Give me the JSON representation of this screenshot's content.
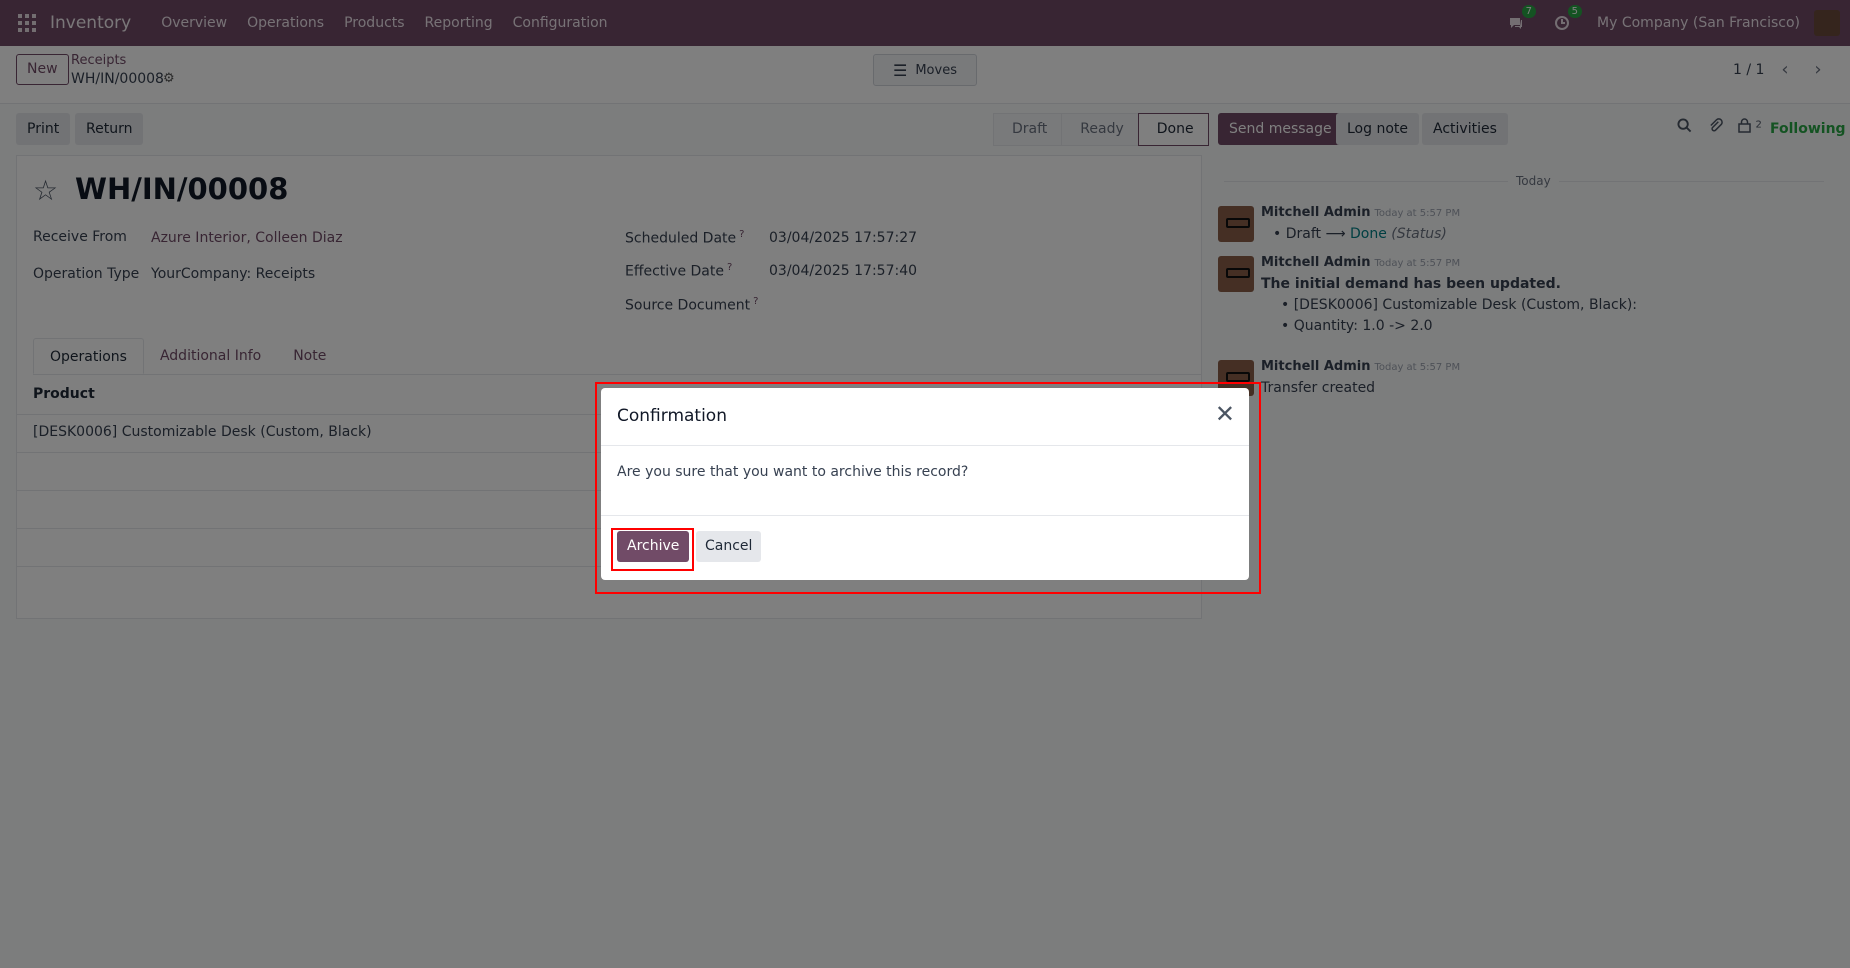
{
  "navbar": {
    "app_name": "Inventory",
    "menu": [
      "Overview",
      "Operations",
      "Products",
      "Reporting",
      "Configuration"
    ],
    "messages_count": "7",
    "activities_count": "5",
    "company": "My Company (San Francisco)"
  },
  "control_panel": {
    "new_label": "New",
    "breadcrumb": "Receipts",
    "record_name": "WH/IN/00008",
    "moves_label": "Moves",
    "pager": "1 / 1"
  },
  "form_header": {
    "print_label": "Print",
    "return_label": "Return",
    "stages": [
      "Draft",
      "Ready",
      "Done"
    ],
    "active_stage": "Done"
  },
  "form": {
    "title": "WH/IN/00008",
    "receive_from_label": "Receive From",
    "receive_from_value": "Azure Interior, Colleen Diaz",
    "operation_type_label": "Operation Type",
    "operation_type_value": "YourCompany: Receipts",
    "scheduled_date_label": "Scheduled Date",
    "scheduled_date_value": "03/04/2025 17:57:27",
    "effective_date_label": "Effective Date",
    "effective_date_value": "03/04/2025 17:57:40",
    "source_document_label": "Source Document",
    "help_mark": "?",
    "tabs": [
      "Operations",
      "Additional Info",
      "Note"
    ],
    "table_header_product": "Product",
    "rows": [
      "[DESK0006] Customizable Desk (Custom, Black)"
    ]
  },
  "chatter": {
    "send_message_label": "Send message",
    "log_note_label": "Log note",
    "activities_label": "Activities",
    "followers_count": "2",
    "following_label": "Following",
    "date_separator": "Today",
    "messages": [
      {
        "author": "Mitchell Admin",
        "time": "Today at 5:57 PM",
        "old_value": "Draft",
        "new_value": "Done",
        "field": "(Status)"
      },
      {
        "author": "Mitchell Admin",
        "time": "Today at 5:57 PM",
        "heading": "The initial demand has been updated.",
        "line1": "[DESK0006] Customizable Desk (Custom, Black):",
        "line2": "Quantity: 1.0 -> 2.0"
      },
      {
        "author": "Mitchell Admin",
        "time": "Today at 5:57 PM",
        "body": "Transfer created"
      }
    ]
  },
  "dialog": {
    "title": "Confirmation",
    "body": "Are you sure that you want to archive this record?",
    "archive_label": "Archive",
    "cancel_label": "Cancel"
  }
}
